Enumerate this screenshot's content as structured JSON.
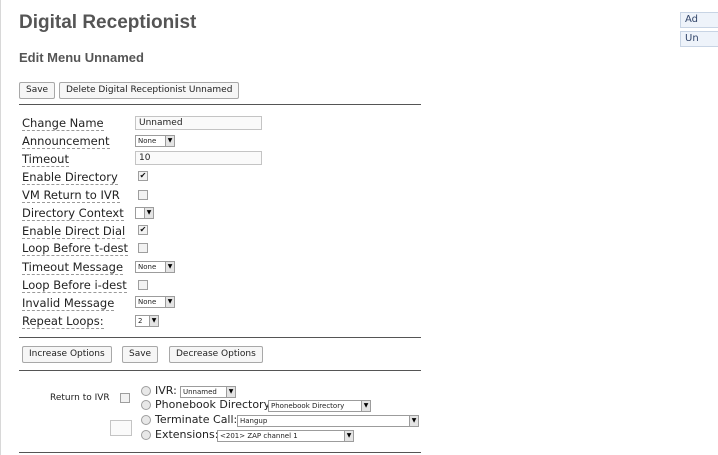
{
  "header": {
    "title": "Digital Receptionist",
    "subtitle": "Edit Menu Unnamed"
  },
  "top_buttons": {
    "save": "Save",
    "delete": "Delete Digital Receptionist Unnamed"
  },
  "form": {
    "change_name": {
      "label": "Change Name",
      "value": "Unnamed"
    },
    "announcement": {
      "label": "Announcement",
      "selected": "None"
    },
    "timeout": {
      "label": "Timeout",
      "value": "10"
    },
    "enable_directory": {
      "label": "Enable Directory",
      "checked": true,
      "mark": "✔"
    },
    "vm_return": {
      "label": "VM Return to IVR",
      "checked": false
    },
    "directory_context": {
      "label": "Directory Context",
      "selected": ""
    },
    "enable_direct_dial": {
      "label": "Enable Direct Dial",
      "checked": true,
      "mark": "✔"
    },
    "loop_t_dest": {
      "label": "Loop Before t-dest",
      "checked": false
    },
    "timeout_message": {
      "label": "Timeout Message",
      "selected": "None"
    },
    "loop_i_dest": {
      "label": "Loop Before i-dest",
      "checked": false
    },
    "invalid_message": {
      "label": "Invalid Message",
      "selected": "None"
    },
    "repeat_loops": {
      "label": "Repeat Loops:",
      "selected": "2"
    }
  },
  "option_buttons": {
    "increase": "Increase Options",
    "save": "Save",
    "decrease": "Decrease Options"
  },
  "destination": {
    "return_label": "Return to IVR",
    "ivr": {
      "label": "IVR:",
      "selected": "Unnamed"
    },
    "phonebook": {
      "label": "Phonebook Directory:",
      "selected": "Phonebook Directory"
    },
    "terminate": {
      "label": "Terminate Call:",
      "selected": "Hangup"
    },
    "extensions": {
      "label": "Extensions:",
      "selected": "<201> ZAP channel 1"
    }
  },
  "side_tabs": {
    "tab1": "Ad",
    "tab2": "Un"
  },
  "icons": {
    "dropdown_arrow": "▼"
  }
}
